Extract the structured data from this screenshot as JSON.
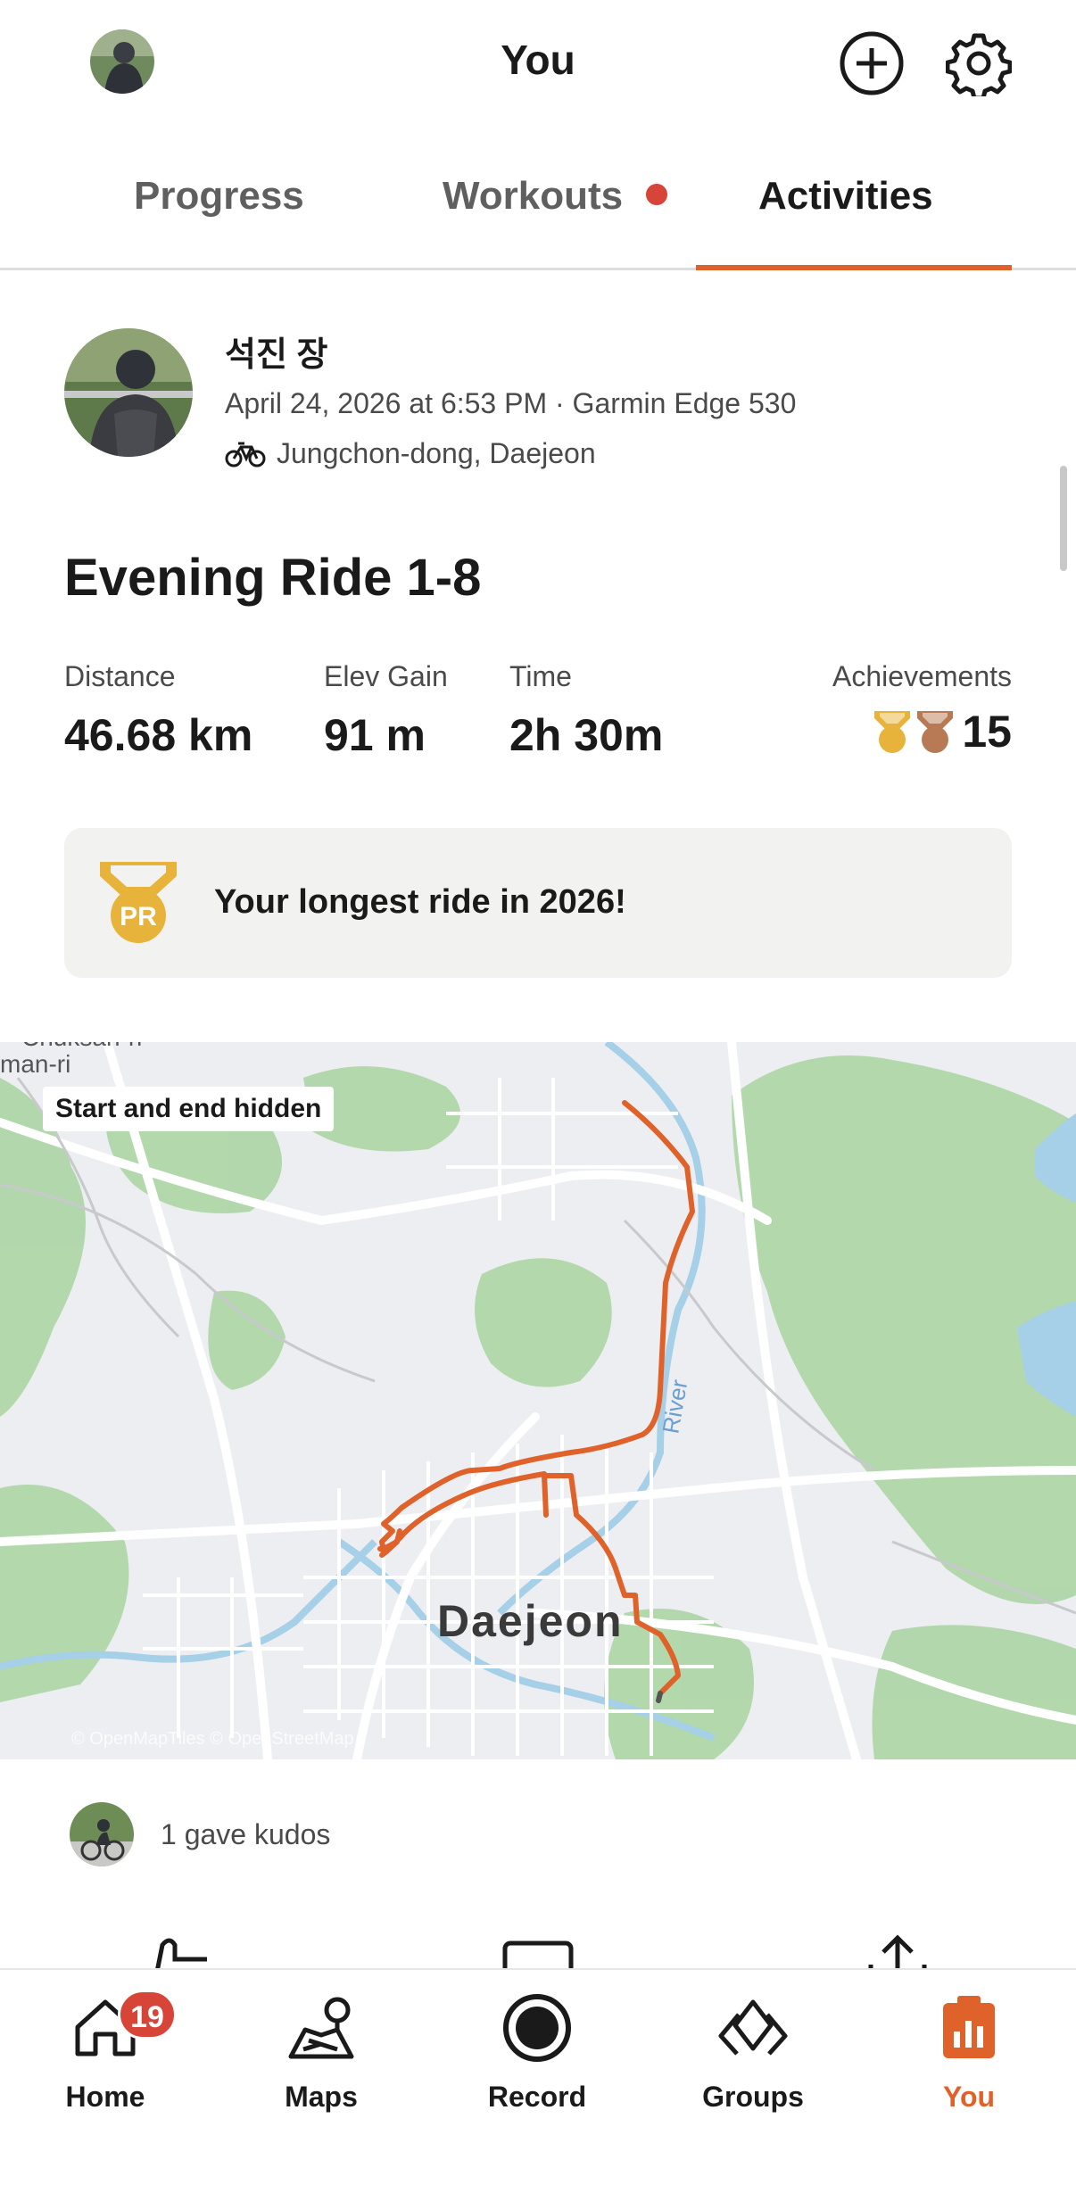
{
  "header": {
    "title": "You"
  },
  "tabs": [
    {
      "label": "Progress"
    },
    {
      "label": "Workouts"
    },
    {
      "label": "Activities"
    }
  ],
  "activity": {
    "athlete_name": "석진 장",
    "meta": "April 24, 2026 at 6:53 PM · Garmin Edge 530",
    "location": "Jungchon-dong, Daejeon",
    "title": "Evening Ride 1-8",
    "stats": {
      "distance_label": "Distance",
      "distance_value": "46.68 km",
      "elev_label": "Elev Gain",
      "elev_value": "91 m",
      "time_label": "Time",
      "time_value": "2h 30m",
      "achievements_label": "Achievements",
      "achievements_value": "15"
    },
    "pr_text": "Your longest ride in 2026!",
    "pr_badge": "PR"
  },
  "map": {
    "badge": "Start and end hidden",
    "city_label": "Daejeon",
    "river_label": "River",
    "area_label_1": "Chuksan-ri",
    "area_label_2": "man-ri",
    "copyright": "© OpenMapTiles © OpenStreetMap"
  },
  "kudos": {
    "text": "1 gave kudos"
  },
  "nav": {
    "home": "Home",
    "home_badge": "19",
    "maps": "Maps",
    "record": "Record",
    "groups": "Groups",
    "you": "You"
  },
  "colors": {
    "accent": "#e0622b",
    "badge_red": "#d64538",
    "gold": "#e8b33a",
    "bronze": "#b87a55"
  }
}
